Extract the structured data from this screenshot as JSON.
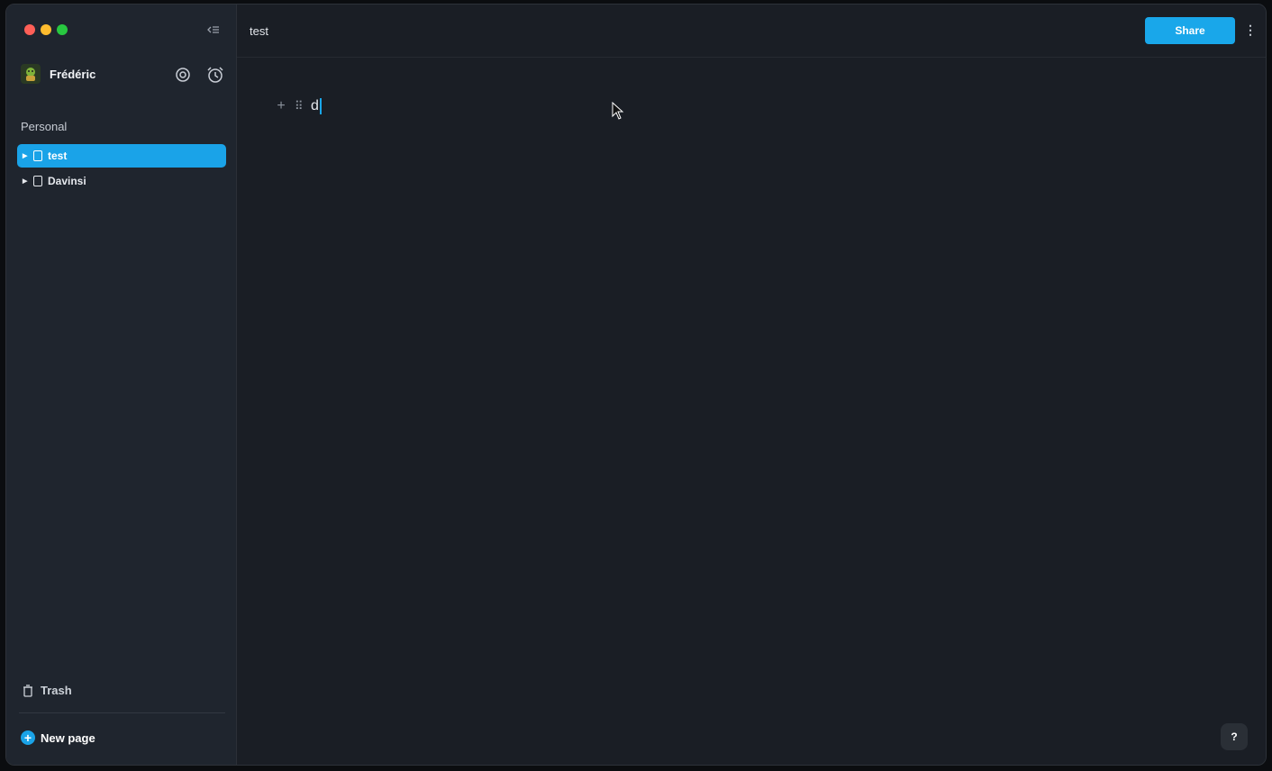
{
  "window": {
    "traffic_colors": [
      "#ff5f57",
      "#febc2e",
      "#28c840"
    ]
  },
  "sidebar": {
    "user_name": "Frédéric",
    "section_label": "Personal",
    "pages": [
      {
        "label": "test",
        "active": true
      },
      {
        "label": "Davinsi",
        "active": false
      }
    ],
    "trash_label": "Trash",
    "new_page_label": "New page",
    "icons": [
      "collapse-sidebar-icon",
      "settings-icon",
      "alarm-clock-icon",
      "trash-icon",
      "plus-circle-icon"
    ]
  },
  "header": {
    "title": "test",
    "share_label": "Share",
    "more_label": "⋮"
  },
  "editor": {
    "add_label": "+",
    "drag_label": "⠿",
    "block_text": "d"
  },
  "help": {
    "label": "?"
  },
  "colors": {
    "accent": "#19a7ea",
    "sidebar_bg": "#1f252e",
    "main_bg": "#1a1e25"
  }
}
